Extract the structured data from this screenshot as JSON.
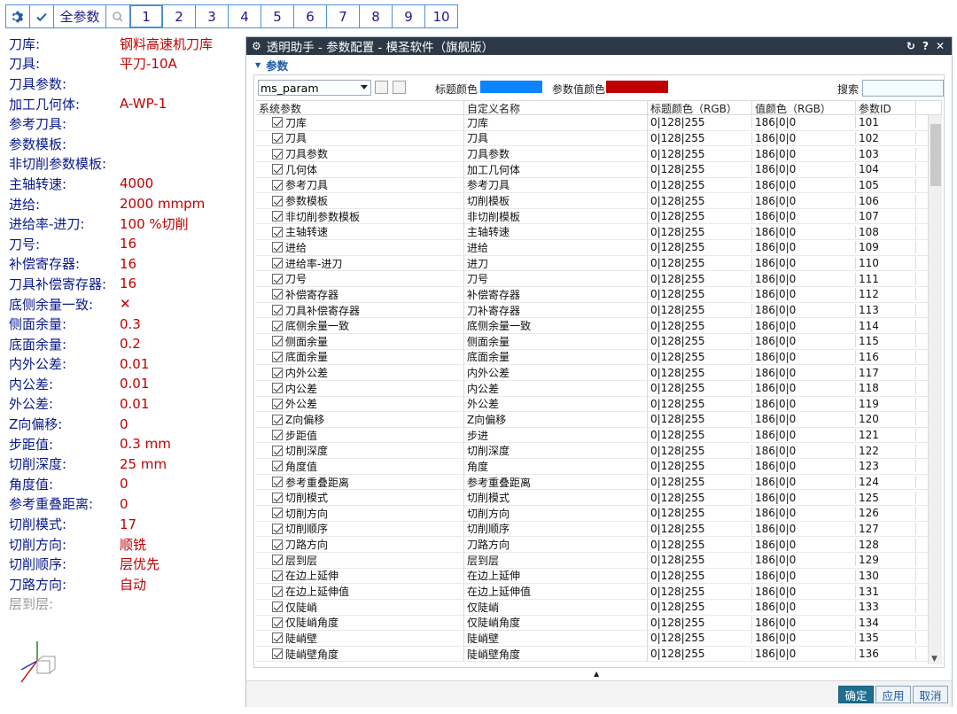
{
  "toolbar": {
    "gear_icon": "gear-icon",
    "check_icon": "check-icon",
    "all_label": "全参数",
    "search_icon": "search-icon",
    "pages": [
      "1",
      "2",
      "3",
      "4",
      "5",
      "6",
      "7",
      "8",
      "9",
      "10"
    ],
    "active_page": "1"
  },
  "left_panel": [
    {
      "label": "刀库:",
      "value": "钢料高速机刀库"
    },
    {
      "label": "刀具:",
      "value": "平刀-10A"
    },
    {
      "label": "刀具参数:",
      "value": ""
    },
    {
      "label": "加工几何体:",
      "value": "A-WP-1"
    },
    {
      "label": "参考刀具:",
      "value": ""
    },
    {
      "label": "参数模板:",
      "value": ""
    },
    {
      "label": "非切削参数模板:",
      "value": ""
    },
    {
      "label": "主轴转速:",
      "value": "4000"
    },
    {
      "label": "进给:",
      "value": "2000  mmpm"
    },
    {
      "label": "进给率-进刀:",
      "value": "100  %切削"
    },
    {
      "label": "刀号:",
      "value": "16"
    },
    {
      "label": "补偿寄存器:",
      "value": "16"
    },
    {
      "label": "刀具补偿寄存器:",
      "value": "16"
    },
    {
      "label": "底侧余量一致:",
      "value": "✕"
    },
    {
      "label": "侧面余量:",
      "value": "0.3"
    },
    {
      "label": "底面余量:",
      "value": "0.2"
    },
    {
      "label": "内外公差:",
      "value": "0.01"
    },
    {
      "label": "内公差:",
      "value": "0.01"
    },
    {
      "label": "外公差:",
      "value": "0.01"
    },
    {
      "label": "Z向偏移:",
      "value": "0"
    },
    {
      "label": "步距值:",
      "value": "0.3  mm"
    },
    {
      "label": "切削深度:",
      "value": "25  mm"
    },
    {
      "label": "角度值:",
      "value": "0"
    },
    {
      "label": "参考重叠距离:",
      "value": "0"
    },
    {
      "label": "切削模式:",
      "value": "17"
    },
    {
      "label": "切削方向:",
      "value": "顺铣"
    },
    {
      "label": "切削顺序:",
      "value": "层优先"
    },
    {
      "label": "刀路方向:",
      "value": "自动"
    },
    {
      "label": "层到层:",
      "value": "",
      "dim": true
    }
  ],
  "dialog": {
    "title": "透明助手 - 参数配置 - 模圣软件（旗舰版）",
    "title_controls": [
      "↻",
      "?",
      "✕"
    ],
    "section": "参数",
    "select_value": "ms_param",
    "title_color_label": "标题颜色",
    "title_color": "#0a84ff",
    "value_color_label": "参数值颜色",
    "value_color": "#c00000",
    "search_label": "搜索",
    "columns": [
      "系统参数",
      "自定义名称",
      "标题颜色（RGB）",
      "值颜色（RGB）",
      "参数ID"
    ],
    "rows": [
      [
        "刀库",
        "刀库",
        "0|128|255",
        "186|0|0",
        "101"
      ],
      [
        "刀具",
        "刀具",
        "0|128|255",
        "186|0|0",
        "102"
      ],
      [
        "刀具参数",
        "刀具参数",
        "0|128|255",
        "186|0|0",
        "103"
      ],
      [
        "几何体",
        "加工几何体",
        "0|128|255",
        "186|0|0",
        "104"
      ],
      [
        "参考刀具",
        "参考刀具",
        "0|128|255",
        "186|0|0",
        "105"
      ],
      [
        "参数模板",
        "切削模板",
        "0|128|255",
        "186|0|0",
        "106"
      ],
      [
        "非切削参数模板",
        "非切削模板",
        "0|128|255",
        "186|0|0",
        "107"
      ],
      [
        "主轴转速",
        "主轴转速",
        "0|128|255",
        "186|0|0",
        "108"
      ],
      [
        "进给",
        "进给",
        "0|128|255",
        "186|0|0",
        "109"
      ],
      [
        "进给率-进刀",
        "进刀",
        "0|128|255",
        "186|0|0",
        "110"
      ],
      [
        "刀号",
        "刀号",
        "0|128|255",
        "186|0|0",
        "111"
      ],
      [
        "补偿寄存器",
        "补偿寄存器",
        "0|128|255",
        "186|0|0",
        "112"
      ],
      [
        "刀具补偿寄存器",
        "刀补寄存器",
        "0|128|255",
        "186|0|0",
        "113"
      ],
      [
        "底侧余量一致",
        "底侧余量一致",
        "0|128|255",
        "186|0|0",
        "114"
      ],
      [
        "侧面余量",
        "侧面余量",
        "0|128|255",
        "186|0|0",
        "115"
      ],
      [
        "底面余量",
        "底面余量",
        "0|128|255",
        "186|0|0",
        "116"
      ],
      [
        "内外公差",
        "内外公差",
        "0|128|255",
        "186|0|0",
        "117"
      ],
      [
        "内公差",
        "内公差",
        "0|128|255",
        "186|0|0",
        "118"
      ],
      [
        "外公差",
        "外公差",
        "0|128|255",
        "186|0|0",
        "119"
      ],
      [
        "Z向偏移",
        "Z向偏移",
        "0|128|255",
        "186|0|0",
        "120"
      ],
      [
        "步距值",
        "步进",
        "0|128|255",
        "186|0|0",
        "121"
      ],
      [
        "切削深度",
        "切削深度",
        "0|128|255",
        "186|0|0",
        "122"
      ],
      [
        "角度值",
        "角度",
        "0|128|255",
        "186|0|0",
        "123"
      ],
      [
        "参考重叠距离",
        "参考重叠距离",
        "0|128|255",
        "186|0|0",
        "124"
      ],
      [
        "切削模式",
        "切削模式",
        "0|128|255",
        "186|0|0",
        "125"
      ],
      [
        "切削方向",
        "切削方向",
        "0|128|255",
        "186|0|0",
        "126"
      ],
      [
        "切削顺序",
        "切削顺序",
        "0|128|255",
        "186|0|0",
        "127"
      ],
      [
        "刀路方向",
        "刀路方向",
        "0|128|255",
        "186|0|0",
        "128"
      ],
      [
        "层到层",
        "层到层",
        "0|128|255",
        "186|0|0",
        "129"
      ],
      [
        "在边上延伸",
        "在边上延伸",
        "0|128|255",
        "186|0|0",
        "130"
      ],
      [
        "在边上延伸值",
        "在边上延伸值",
        "0|128|255",
        "186|0|0",
        "131"
      ],
      [
        "仅陡峭",
        "仅陡峭",
        "0|128|255",
        "186|0|0",
        "133"
      ],
      [
        "仅陡峭角度",
        "仅陡峭角度",
        "0|128|255",
        "186|0|0",
        "134"
      ],
      [
        "陡峭壁",
        "陡峭壁",
        "0|128|255",
        "186|0|0",
        "135"
      ],
      [
        "陡峭壁角度",
        "陡峭壁角度",
        "0|128|255",
        "186|0|0",
        "136"
      ]
    ],
    "ok_label": "确定",
    "apply_label": "应用",
    "cancel_label": "取消"
  }
}
